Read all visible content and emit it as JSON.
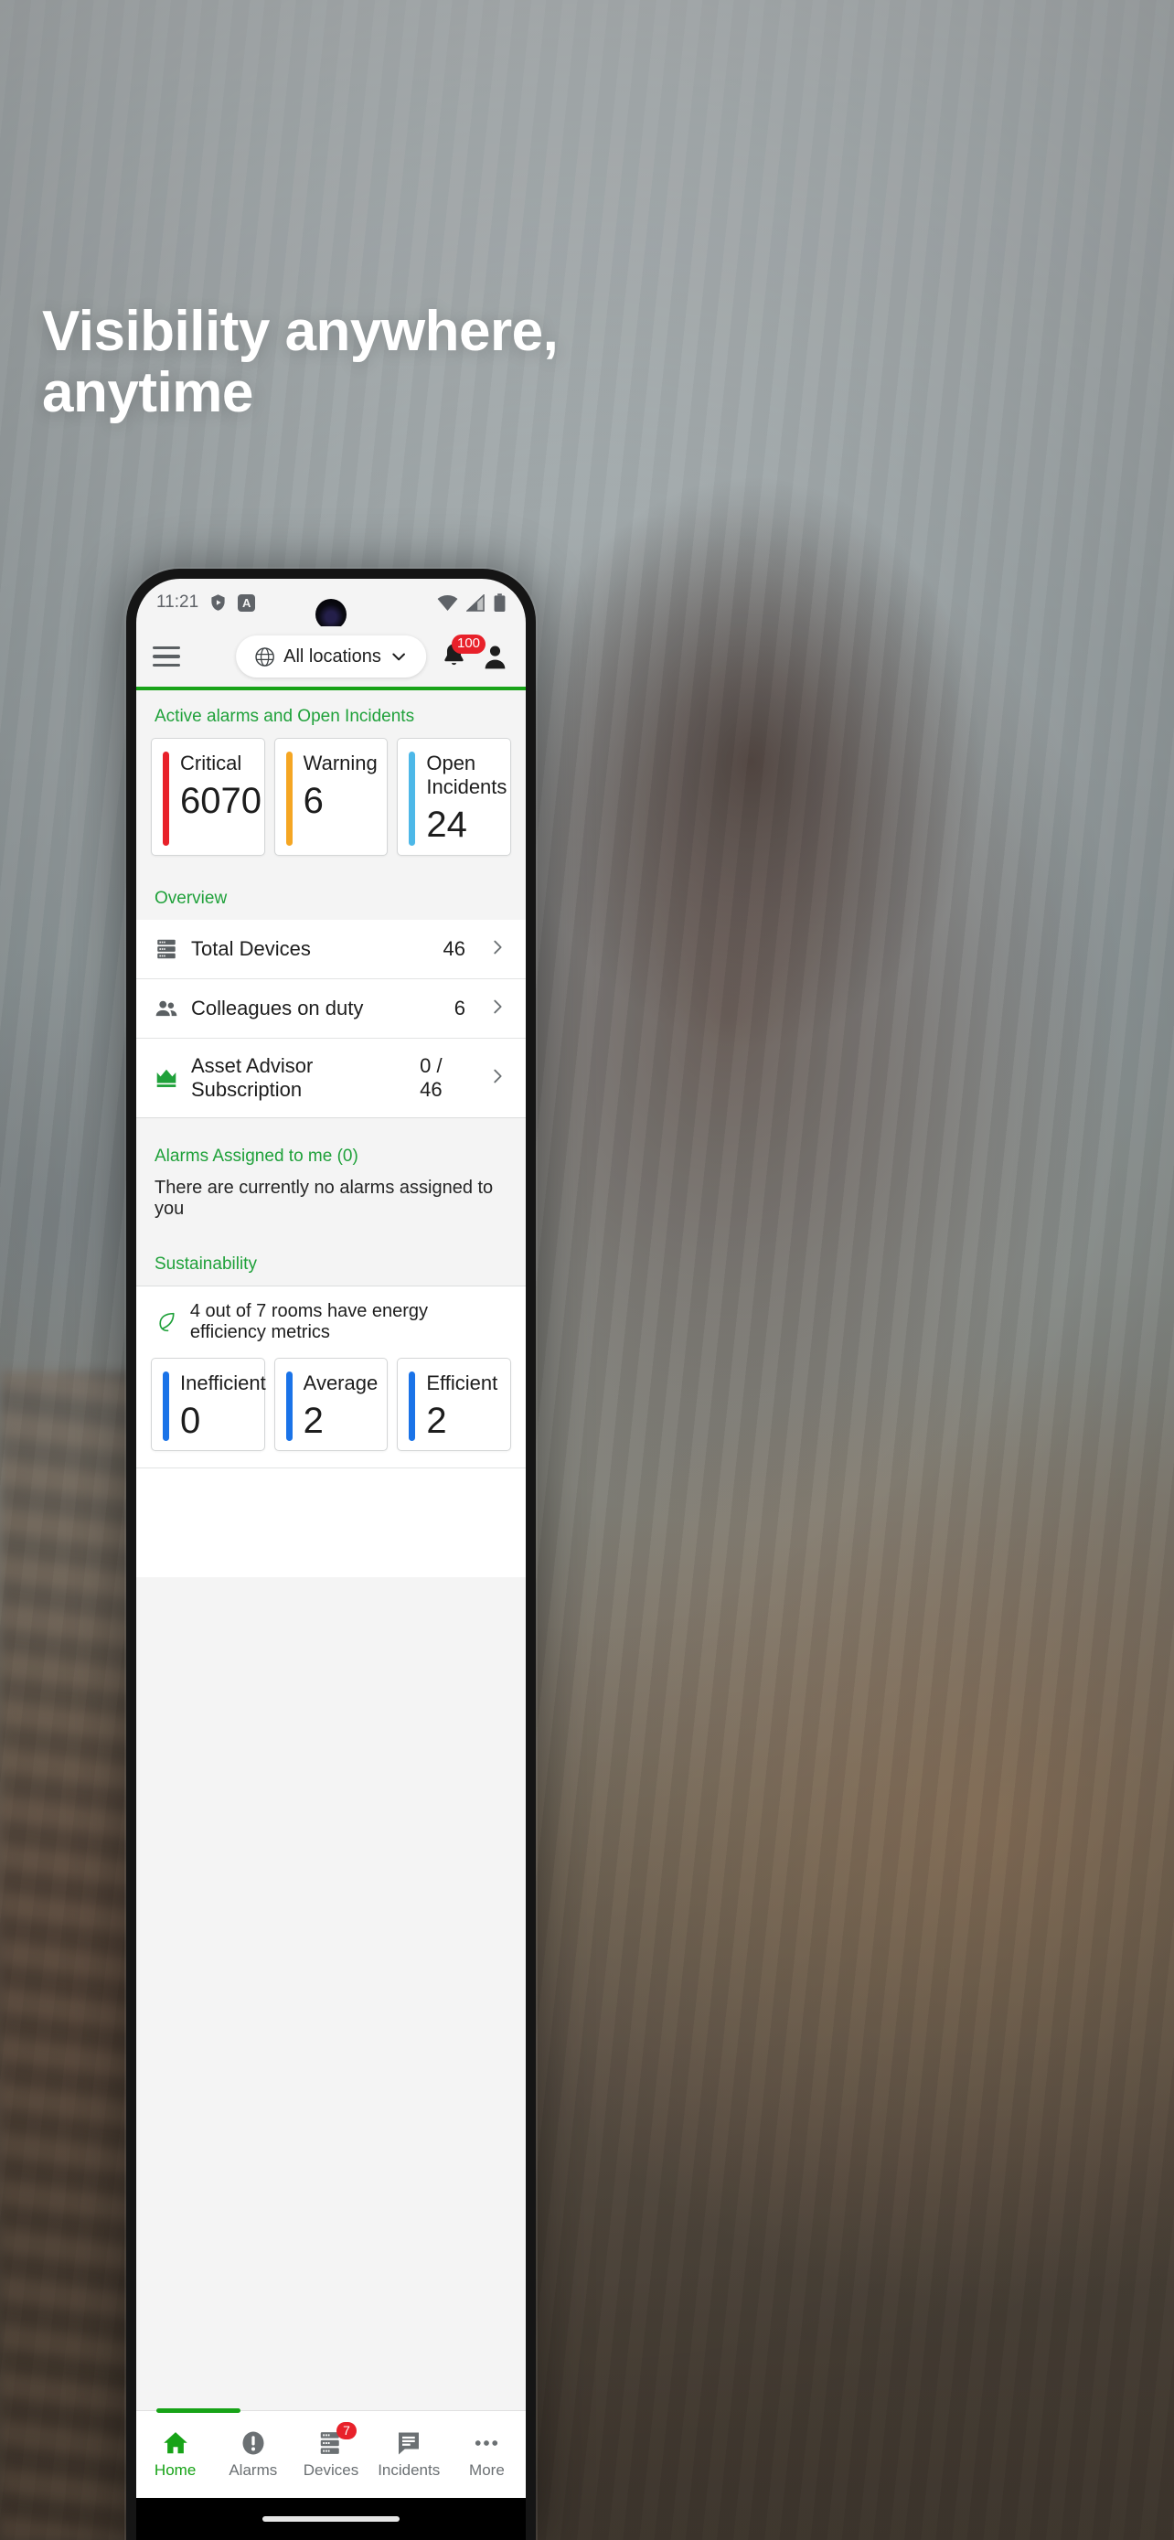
{
  "hero": {
    "headline_line1": "Visibility anywhere,",
    "headline_line2": "anytime"
  },
  "statusbar": {
    "time": "11:21",
    "icons": [
      "shield-play-icon",
      "a-badge-icon",
      "wifi-icon",
      "cellular-icon",
      "battery-icon"
    ]
  },
  "appbar": {
    "menu_icon": "hamburger-icon",
    "location_label": "All locations",
    "location_icon": "globe-icon",
    "chevron": "chevron-down-icon",
    "notification_badge": "100",
    "bell_icon": "bell-icon",
    "profile_icon": "person-icon",
    "accent_color": "#18a318"
  },
  "alarms": {
    "section_label": "Active alarms and Open Incidents",
    "cards": [
      {
        "title": "Critical",
        "value": "6070",
        "color": "#e8212a"
      },
      {
        "title": "Warning",
        "value": "6",
        "color": "#f5a623"
      },
      {
        "title": "Open Incidents",
        "value": "24",
        "color": "#4db8e8"
      }
    ]
  },
  "overview": {
    "section_label": "Overview",
    "rows": [
      {
        "icon": "server-rack-icon",
        "label": "Total Devices",
        "value": "46",
        "chevron": "chevron-right-icon"
      },
      {
        "icon": "people-icon",
        "label": "Colleagues on duty",
        "value": "6",
        "chevron": "chevron-right-icon"
      },
      {
        "icon": "crown-icon",
        "label": "Asset Advisor Subscription",
        "value": "0 / 46",
        "chevron": "chevron-right-icon"
      }
    ]
  },
  "assigned": {
    "section_label": "Alarms Assigned to me (0)",
    "empty_text": "There are currently no alarms assigned to you"
  },
  "sustainability": {
    "section_label": "Sustainability",
    "leaf_icon": "leaf-icon",
    "summary": "4 out of 7 rooms have energy efficiency metrics",
    "cards": [
      {
        "title": "Inefficient",
        "value": "0",
        "color": "#1a73e8"
      },
      {
        "title": "Average",
        "value": "2",
        "color": "#1a73e8"
      },
      {
        "title": "Efficient",
        "value": "2",
        "color": "#1a73e8"
      }
    ]
  },
  "bottomnav": {
    "items": [
      {
        "label": "Home",
        "icon": "home-icon",
        "active": true,
        "badge": ""
      },
      {
        "label": "Alarms",
        "icon": "alert-circle-icon",
        "active": false,
        "badge": ""
      },
      {
        "label": "Devices",
        "icon": "server-rack-icon",
        "active": false,
        "badge": "7"
      },
      {
        "label": "Incidents",
        "icon": "message-lines-icon",
        "active": false,
        "badge": ""
      },
      {
        "label": "More",
        "icon": "ellipsis-icon",
        "active": false,
        "badge": ""
      }
    ]
  }
}
